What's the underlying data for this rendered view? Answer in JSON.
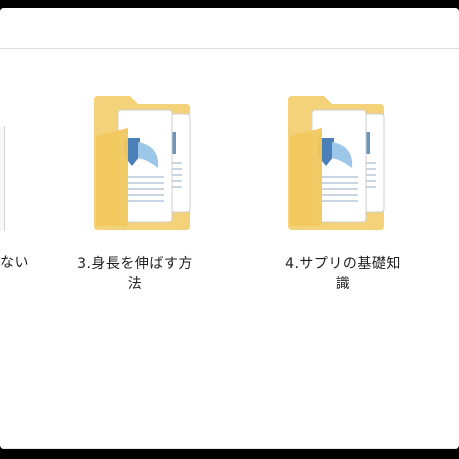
{
  "explorer": {
    "items": [
      {
        "label": "ない"
      },
      {
        "label_line1": "3.身長を伸ばす方",
        "label_line2": "法"
      },
      {
        "label_line1": "4.サプリの基礎知",
        "label_line2": "識"
      }
    ]
  }
}
